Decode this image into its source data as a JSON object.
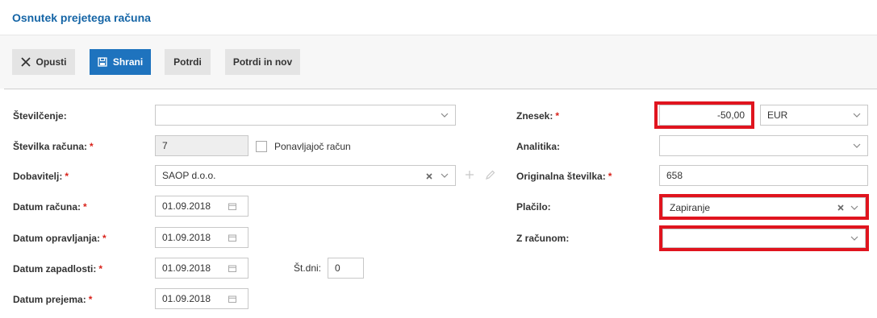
{
  "header": {
    "title": "Osnutek prejetega računa"
  },
  "toolbar": {
    "cancel_label": "Opusti",
    "save_label": "Shrani",
    "confirm_label": "Potrdi",
    "confirm_new_label": "Potrdi in nov"
  },
  "form": {
    "numbering": {
      "label": "Številčenje:",
      "value": ""
    },
    "invoice_number": {
      "label": "Številka računa:",
      "value": "7"
    },
    "recurring": {
      "label": "Ponavljajoč račun",
      "checked": false
    },
    "supplier": {
      "label": "Dobavitelj:",
      "value": "SAOP d.o.o."
    },
    "invoice_date": {
      "label": "Datum računa:",
      "value": "01.09.2018"
    },
    "service_date": {
      "label": "Datum opravljanja:",
      "value": "01.09.2018"
    },
    "due_date": {
      "label": "Datum zapadlosti:",
      "value": "01.09.2018"
    },
    "days": {
      "label": "Št.dni:",
      "value": "0"
    },
    "receipt_date": {
      "label": "Datum prejema:",
      "value": "01.09.2018"
    },
    "amount": {
      "label": "Znesek:",
      "value": "-50,00",
      "currency": "EUR"
    },
    "analytics": {
      "label": "Analitika:",
      "value": ""
    },
    "original_number": {
      "label": "Originalna številka:",
      "value": "658"
    },
    "payment": {
      "label": "Plačilo:",
      "value": "Zapiranje"
    },
    "with_invoice": {
      "label": "Z računom:",
      "value": ""
    },
    "required_mark": "*"
  },
  "colors": {
    "accent": "#1e73be",
    "title": "#1565a6",
    "required": "#d9231b",
    "highlight": "#e0141e"
  }
}
